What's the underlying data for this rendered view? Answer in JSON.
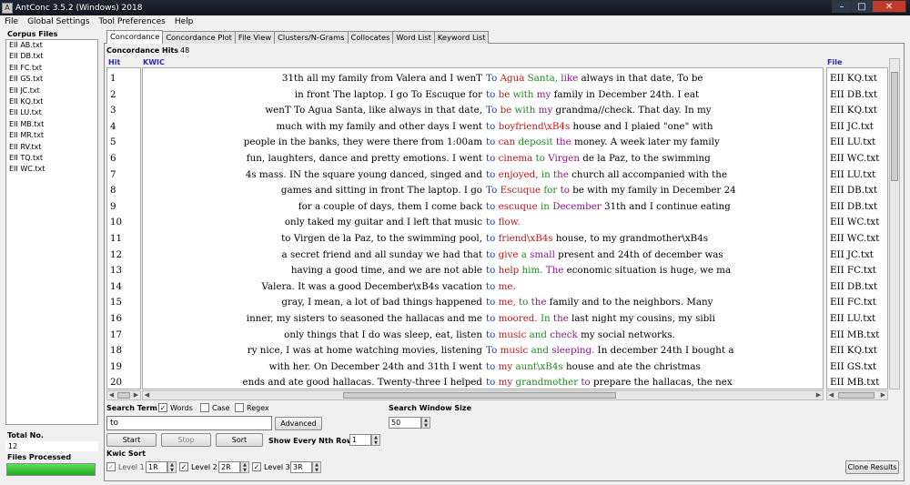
{
  "window": {
    "title": "AntConc 3.5.2 (Windows) 2018"
  },
  "menu": [
    "File",
    "Global Settings",
    "Tool Preferences",
    "Help"
  ],
  "corpus": {
    "label": "Corpus Files",
    "files": [
      "EII AB.txt",
      "EII DB.txt",
      "EII FC.txt",
      "EII GS.txt",
      "EII JC.txt",
      "EII KQ.txt",
      "EII LU.txt",
      "EII MB.txt",
      "EII MR.txt",
      "EII RV.txt",
      "EII TQ.txt",
      "EII WC.txt"
    ],
    "total_label": "Total No.",
    "total_value": "12",
    "files_processed_label": "Files Processed",
    "progress": 1.0
  },
  "tabs": [
    "Concordance",
    "Concordance Plot",
    "File View",
    "Clusters/N-Grams",
    "Collocates",
    "Word List",
    "Keyword List"
  ],
  "concordance": {
    "hits_label": "Concordance Hits",
    "hits_value": "48",
    "col_hit": "Hit",
    "col_kwic": "KWIC",
    "col_file": "File",
    "rows": [
      {
        "hit": "1",
        "left": "31th all my family from Valera and I wenT",
        "kw": "To",
        "right": [
          [
            "Agua",
            "c-red"
          ],
          [
            " Santa,",
            "c-green"
          ],
          [
            " like",
            "c-purple"
          ],
          [
            " always in that date, To be",
            ""
          ]
        ],
        "file": "EII KQ.txt"
      },
      {
        "hit": "2",
        "left": "in front The laptop. I go To Escuque for",
        "kw": "to",
        "right": [
          [
            "be",
            "c-red"
          ],
          [
            " with",
            "c-green"
          ],
          [
            " my",
            "c-purple"
          ],
          [
            " family in December 24th. I eat",
            ""
          ]
        ],
        "file": "EII DB.txt"
      },
      {
        "hit": "3",
        "left": "wenT To Agua Santa, like always in that date,",
        "kw": "To",
        "right": [
          [
            "be",
            "c-red"
          ],
          [
            " with",
            "c-green"
          ],
          [
            " my",
            "c-purple"
          ],
          [
            " grandma//check. That day. In my",
            ""
          ]
        ],
        "file": "EII KQ.txt"
      },
      {
        "hit": "4",
        "left": "much with my family and other days I went",
        "kw": "to",
        "right": [
          [
            "boyfriend\\xB4s",
            "c-red"
          ],
          [
            " house and I plaied \"one\" with",
            ""
          ]
        ],
        "file": "EII JC.txt"
      },
      {
        "hit": "5",
        "left": "people in the banks, they were there from 1:00am",
        "kw": "to",
        "right": [
          [
            "can",
            "c-red"
          ],
          [
            " deposit",
            "c-green"
          ],
          [
            " the",
            "c-purple"
          ],
          [
            " money. A week later my family",
            ""
          ]
        ],
        "file": "EII LU.txt"
      },
      {
        "hit": "6",
        "left": "fun, laughters, dance and pretty emotions. I went",
        "kw": "to",
        "right": [
          [
            "cinema",
            "c-red"
          ],
          [
            " to",
            "c-green"
          ],
          [
            " Virgen",
            "c-purple"
          ],
          [
            " de la Paz, to the swimming",
            ""
          ]
        ],
        "file": "EII WC.txt"
      },
      {
        "hit": "7",
        "left": "4s mass. IN the square young danced, singed and",
        "kw": "to",
        "right": [
          [
            "enjoyed,",
            "c-red"
          ],
          [
            " in",
            "c-green"
          ],
          [
            " the",
            "c-purple"
          ],
          [
            " church all accompanied with the",
            ""
          ]
        ],
        "file": "EII LU.txt"
      },
      {
        "hit": "8",
        "left": "games and sitting in front The laptop. I go",
        "kw": "To",
        "right": [
          [
            "Escuque",
            "c-red"
          ],
          [
            " for",
            "c-green"
          ],
          [
            " to",
            "c-purple"
          ],
          [
            " be with my family in December 24",
            ""
          ]
        ],
        "file": "EII DB.txt"
      },
      {
        "hit": "9",
        "left": "for a couple of days, them I come back",
        "kw": "to",
        "right": [
          [
            "escuque",
            "c-red"
          ],
          [
            " in",
            "c-green"
          ],
          [
            " December",
            "c-purple"
          ],
          [
            " 31th and I continue eating",
            ""
          ]
        ],
        "file": "EII DB.txt"
      },
      {
        "hit": "10",
        "left": "only taked my guitar and I left that music",
        "kw": "to",
        "right": [
          [
            "flow.",
            "c-red"
          ]
        ],
        "file": "EII WC.txt"
      },
      {
        "hit": "11",
        "left": "to Virgen de la Paz, to the swimming pool,",
        "kw": "to",
        "right": [
          [
            "friend\\xB4s",
            "c-red"
          ],
          [
            " house, to my grandmother\\xB4s",
            ""
          ]
        ],
        "file": "EII WC.txt"
      },
      {
        "hit": "12",
        "left": "a secret friend and all sunday we had that",
        "kw": "to",
        "right": [
          [
            "give",
            "c-red"
          ],
          [
            " a",
            "c-green"
          ],
          [
            " small",
            "c-purple"
          ],
          [
            " present and 24th of december was",
            ""
          ]
        ],
        "file": "EII JC.txt"
      },
      {
        "hit": "13",
        "left": "having a good time, and we are not able",
        "kw": "to",
        "right": [
          [
            "help",
            "c-red"
          ],
          [
            " him.",
            "c-green"
          ],
          [
            " The",
            "c-purple"
          ],
          [
            " economic situation is huge, we ma",
            ""
          ]
        ],
        "file": "EII FC.txt"
      },
      {
        "hit": "14",
        "left": "Valera. It was a good December\\xB4s vacation",
        "kw": "to",
        "right": [
          [
            "me.",
            "c-red"
          ]
        ],
        "file": "EII DB.txt"
      },
      {
        "hit": "15",
        "left": "gray, I mean, a lot of bad things happened",
        "kw": "to",
        "right": [
          [
            "me,",
            "c-red"
          ],
          [
            " to",
            "c-green"
          ],
          [
            " the",
            "c-purple"
          ],
          [
            " family and to the neighbors. Many",
            ""
          ]
        ],
        "file": "EII FC.txt"
      },
      {
        "hit": "16",
        "left": "inner, my sisters to seasoned the hallacas and me",
        "kw": "to",
        "right": [
          [
            "moored.",
            "c-red"
          ],
          [
            " In",
            "c-green"
          ],
          [
            " the",
            "c-purple"
          ],
          [
            " last night  my cousins, my sibli",
            ""
          ]
        ],
        "file": "EII LU.txt"
      },
      {
        "hit": "17",
        "left": "only things that I do was sleep, eat, listen",
        "kw": "to",
        "right": [
          [
            "music",
            "c-red"
          ],
          [
            " and",
            "c-green"
          ],
          [
            " check",
            "c-purple"
          ],
          [
            " my social networks.",
            ""
          ]
        ],
        "file": "EII MB.txt"
      },
      {
        "hit": "18",
        "left": "ry nice, I was at home watching movies, listening",
        "kw": "To",
        "right": [
          [
            "music",
            "c-red"
          ],
          [
            " and",
            "c-green"
          ],
          [
            " sleeping.",
            "c-purple"
          ],
          [
            " In december 24th I bought a",
            ""
          ]
        ],
        "file": "EII KQ.txt"
      },
      {
        "hit": "19",
        "left": "with her. On December 24th and 31th I went",
        "kw": "to",
        "right": [
          [
            "my",
            "c-red"
          ],
          [
            " aunt\\xB4s",
            "c-green"
          ],
          [
            " house and ate the christmas",
            ""
          ]
        ],
        "file": "EII GS.txt"
      },
      {
        "hit": "20",
        "left": "ends and ate good hallacas. Twenty-three I helped",
        "kw": "to",
        "right": [
          [
            "my",
            "c-red"
          ],
          [
            " grandmother",
            "c-green"
          ],
          [
            " to",
            "c-purple"
          ],
          [
            " prepare the hallacas, the nex",
            ""
          ]
        ],
        "file": "EII MB.txt"
      }
    ]
  },
  "controls": {
    "search_term_label": "Search Term",
    "words_label": "Words",
    "case_label": "Case",
    "regex_label": "Regex",
    "search_value": "to",
    "advanced_label": "Advanced",
    "search_window_label": "Search Window Size",
    "search_window_value": "50",
    "start_label": "Start",
    "stop_label": "Stop",
    "sort_label": "Sort",
    "nth_label": "Show Every Nth Row",
    "nth_value": "1",
    "kwic_sort_label": "Kwic Sort",
    "level1_label": "Level 1",
    "level1_value": "1R",
    "level2_label": "Level 2",
    "level2_value": "2R",
    "level3_label": "Level 3",
    "level3_value": "3R",
    "clone_label": "Clone Results"
  }
}
